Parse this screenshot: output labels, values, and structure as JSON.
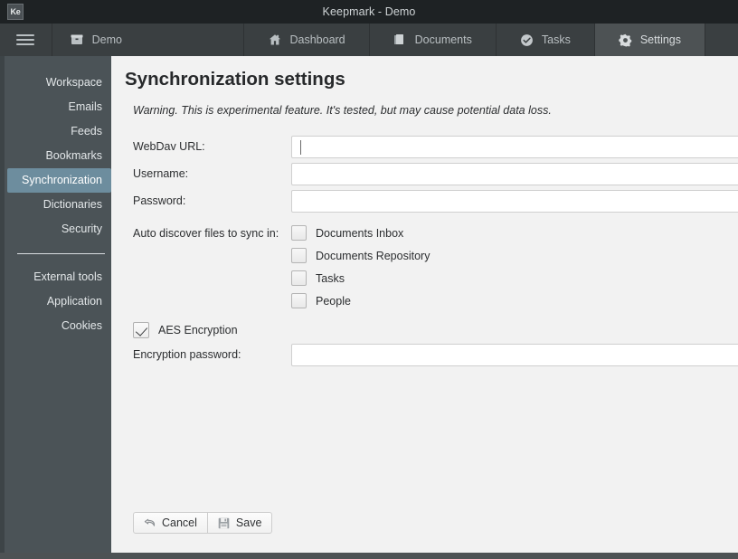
{
  "window": {
    "app_icon_label": "Ke",
    "title": "Keepmark - Demo"
  },
  "tabbar": {
    "menu_icon": "hamburger-icon",
    "tabs": [
      {
        "label": "Demo",
        "icon": "archive-box-icon",
        "active": false
      },
      {
        "label": "Dashboard",
        "icon": "home-icon",
        "active": false
      },
      {
        "label": "Documents",
        "icon": "documents-icon",
        "active": false
      },
      {
        "label": "Tasks",
        "icon": "check-circle-icon",
        "active": false
      },
      {
        "label": "Settings",
        "icon": "gear-icon",
        "active": true
      }
    ]
  },
  "sidebar": {
    "group_one": [
      {
        "label": "Workspace",
        "selected": false
      },
      {
        "label": "Emails",
        "selected": false
      },
      {
        "label": "Feeds",
        "selected": false
      },
      {
        "label": "Bookmarks",
        "selected": false
      },
      {
        "label": "Synchronization",
        "selected": true
      },
      {
        "label": "Dictionaries",
        "selected": false
      },
      {
        "label": "Security",
        "selected": false
      }
    ],
    "group_two": [
      {
        "label": "External tools",
        "selected": false
      },
      {
        "label": "Application",
        "selected": false
      },
      {
        "label": "Cookies",
        "selected": false
      }
    ],
    "selected_color": "#6d8d9e",
    "background_color": "#4b5357"
  },
  "main": {
    "title": "Synchronization settings",
    "warning": "Warning. This is experimental feature. It's tested, but may cause potential data loss.",
    "fields": [
      {
        "label": "WebDav URL:",
        "value": "",
        "focused": true
      },
      {
        "label": "Username:",
        "value": "",
        "focused": false
      },
      {
        "label": "Password:",
        "value": "",
        "focused": false
      }
    ],
    "autodiscover": {
      "label": "Auto discover files to sync in:",
      "options": [
        {
          "label": "Documents Inbox",
          "checked": false
        },
        {
          "label": "Documents Repository",
          "checked": false
        },
        {
          "label": "Tasks",
          "checked": false
        },
        {
          "label": "People",
          "checked": false
        }
      ]
    },
    "encryption": {
      "checkbox_label": "AES Encryption",
      "checked": true,
      "password_label": "Encryption password:",
      "password_value": ""
    },
    "buttons": [
      {
        "label": "Cancel",
        "icon": "undo-arrow-icon"
      },
      {
        "label": "Save",
        "icon": "floppy-disk-icon"
      }
    ]
  }
}
